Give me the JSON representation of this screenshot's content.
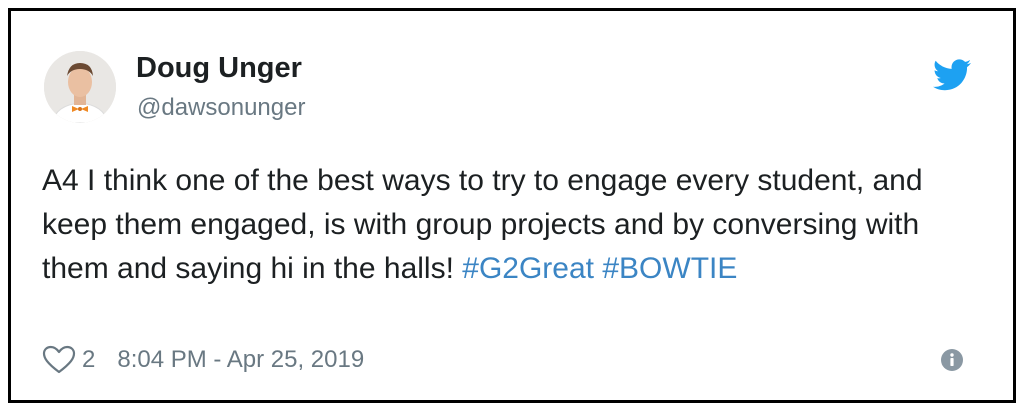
{
  "author": {
    "name": "Doug Unger",
    "handle": "@dawsonunger"
  },
  "tweet": {
    "text": "A4 I think one of the best ways to try to engage every student, and keep them engaged, is with group projects and by conversing with them and saying hi in the halls!",
    "hashtags": [
      "#G2Great",
      "#BOWTIE"
    ]
  },
  "footer": {
    "like_count": "2",
    "timestamp": "8:04 PM - Apr 25, 2019"
  },
  "icons": {
    "brand": "twitter-bird-icon",
    "like": "heart-outline-icon",
    "info": "info-circle-icon"
  },
  "colors": {
    "brand_blue": "#1da1f2",
    "hashtag_blue": "#3b85c4",
    "text": "#1c2022",
    "muted": "#697882"
  }
}
